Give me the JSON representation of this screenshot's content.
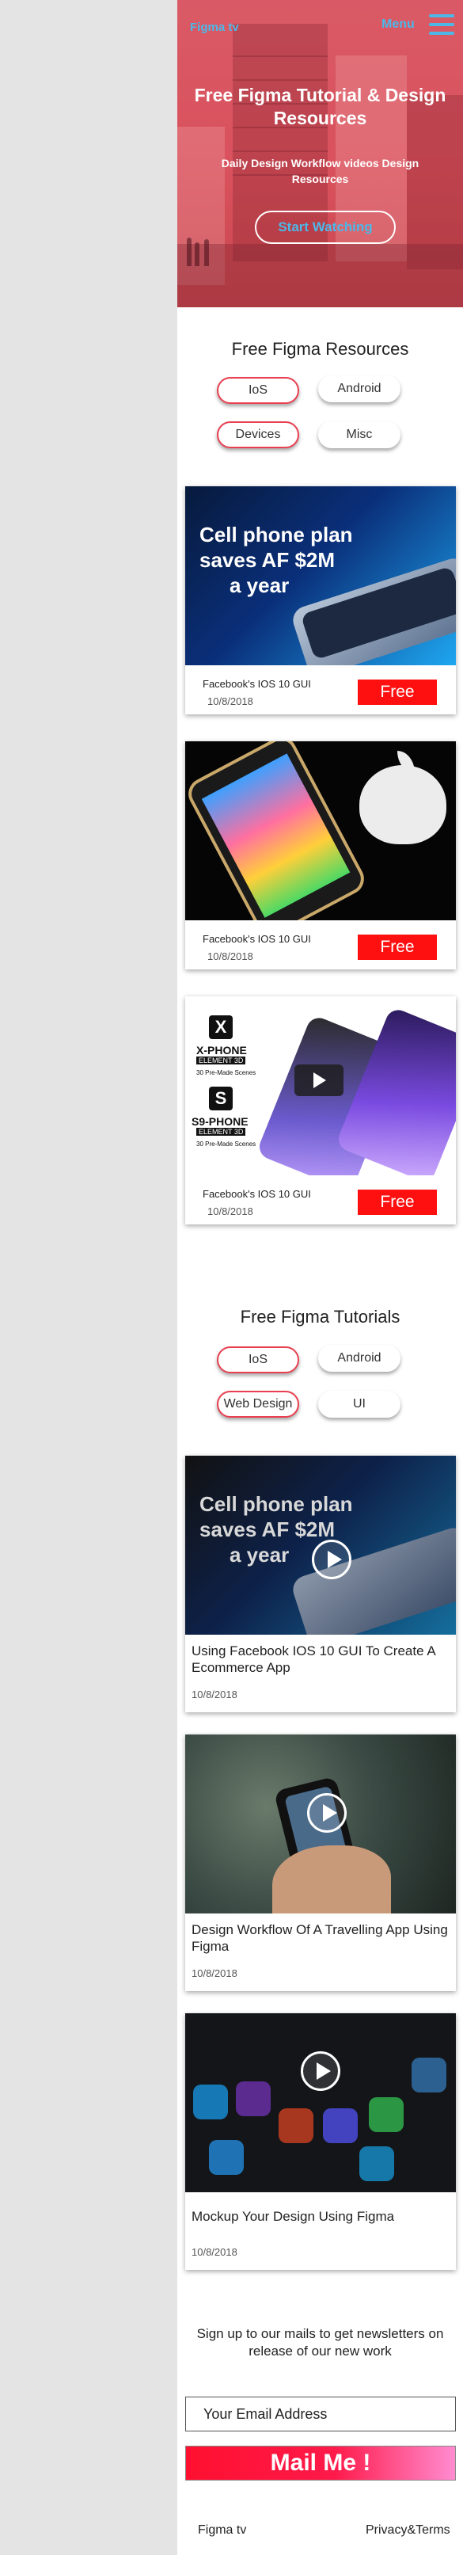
{
  "header": {
    "brand": "Figma tv",
    "menu_label": "Menu",
    "menu_icon": "hamburger-icon",
    "accent": "#4cb8e8"
  },
  "hero": {
    "title": "Free Figma Tutorial & Design Resources",
    "subtitle": "Daily Design Workflow videos Design Resources",
    "cta": "Start Watching",
    "overlay_color": "#d9515c"
  },
  "resources": {
    "title": "Free Figma Resources",
    "filters": [
      "IoS",
      "Android",
      "Devices",
      "Misc"
    ],
    "cards": [
      {
        "title": "Facebook's IOS 10 GUI",
        "date": "10/8/2018",
        "badge": "Free",
        "image_text": [
          "Cell phone plan",
          "saves AF $2M",
          "a year"
        ]
      },
      {
        "title": "Facebook's IOS 10 GUI",
        "date": "10/8/2018",
        "badge": "Free"
      },
      {
        "title": "Facebook's IOS 10 GUI",
        "date": "10/8/2018",
        "badge": "Free",
        "image_text": [
          "X-PHONE",
          "ELEMENT 3D",
          "30 Pre-Made Scenes",
          "S9-PHONE",
          "ELEMENT 3D",
          "30 Pre-Made Scenes"
        ]
      }
    ],
    "badge_color": "#ff1010"
  },
  "tutorials": {
    "title": "Free Figma Tutorials",
    "filters": [
      "IoS",
      "Android",
      "Web Design",
      "UI"
    ],
    "cards": [
      {
        "title": "Using Facebook IOS 10 GUI To Create A Ecommerce App",
        "date": "10/8/2018",
        "image_text": [
          "Cell phone plan",
          "saves AF $2M",
          "a year"
        ]
      },
      {
        "title": "Design Workflow Of A Travelling App Using Figma",
        "date": "10/8/2018"
      },
      {
        "title": "Mockup Your Design Using Figma",
        "date": "10/8/2018"
      }
    ]
  },
  "newsletter": {
    "text": "Sign up to our mails to get newsletters on release of our new work",
    "email_placeholder": "Your Email Address",
    "button": "Mail Me !"
  },
  "footer": {
    "brand": "Figma tv",
    "terms": "Privacy&Terms"
  }
}
